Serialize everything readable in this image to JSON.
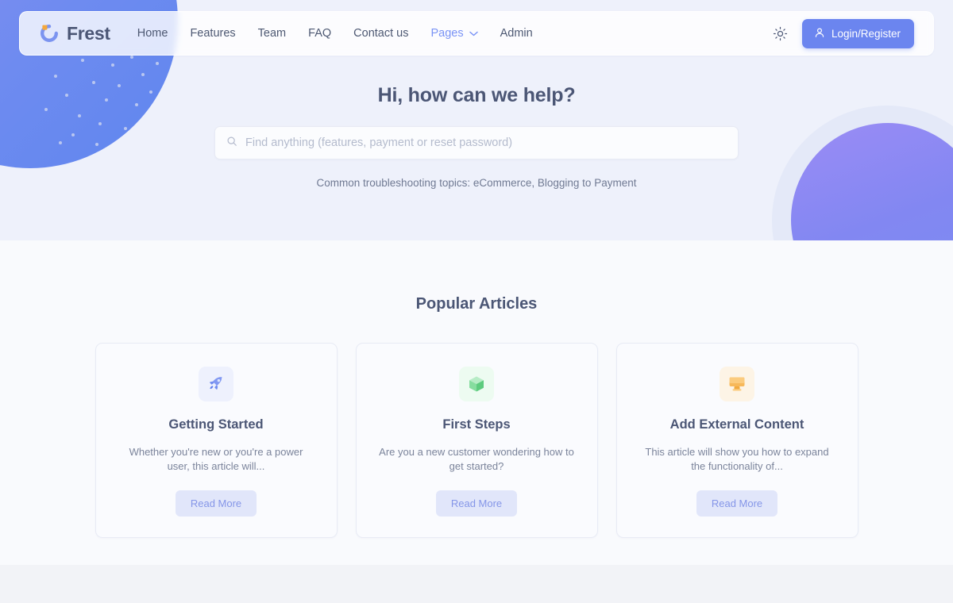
{
  "navbar": {
    "brand": {
      "name": "Frest",
      "logo_icon": "frest-spinner-logo"
    },
    "links": [
      {
        "label": "Home",
        "active": false
      },
      {
        "label": "Features",
        "active": false
      },
      {
        "label": "Team",
        "active": false
      },
      {
        "label": "FAQ",
        "active": false
      },
      {
        "label": "Contact us",
        "active": false
      },
      {
        "label": "Pages",
        "active": true,
        "has_chevron": true
      },
      {
        "label": "Admin",
        "active": false
      }
    ],
    "theme_toggle_icon": "sun-icon",
    "login_button": {
      "label": "Login/Register",
      "icon": "user-icon"
    }
  },
  "hero": {
    "title": "Hi, how can we help?",
    "search": {
      "placeholder": "Find anything (features, payment or reset password)",
      "value": "",
      "icon": "search-icon"
    },
    "subtitle": "Common troubleshooting topics: eCommerce, Blogging to Payment"
  },
  "articles": {
    "heading": "Popular Articles",
    "cards": [
      {
        "icon": "rocket-icon",
        "icon_bg": "#eef1fd",
        "title": "Getting Started",
        "description": "Whether you're new or you're a power user, this article will...",
        "button_label": "Read More"
      },
      {
        "icon": "cube-icon",
        "icon_bg": "#edfbf1",
        "title": "First Steps",
        "description": "Are you a new customer wondering how to get started?",
        "button_label": "Read More"
      },
      {
        "icon": "monitor-icon",
        "icon_bg": "#fdf4e6",
        "title": "Add External Content",
        "description": "This article will show you how to expand the functionality of...",
        "button_label": "Read More"
      }
    ]
  },
  "colors": {
    "primary": "#6b85ef",
    "accent_orange": "#f5a83c",
    "hero_bg": "#eef1fb",
    "body_bg": "#f9fafd",
    "footer_bg": "#f2f3f7",
    "heading_text": "#4b5675",
    "muted_text": "#7b849b",
    "read_more_bg": "#e1e6fa",
    "read_more_text": "#8596e8"
  }
}
